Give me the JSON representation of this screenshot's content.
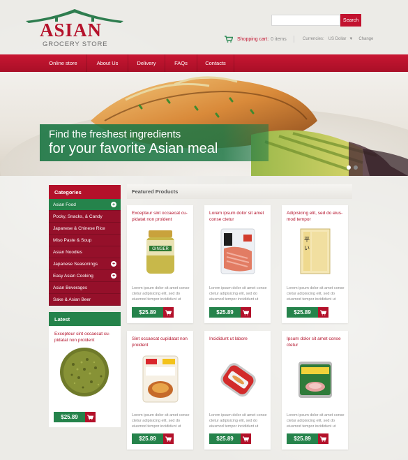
{
  "header": {
    "logo_title": "ASIAN",
    "logo_subtitle": "GROCERY STORE",
    "search": {
      "placeholder": "",
      "button_label": "Search"
    },
    "cart": {
      "label": "Shopping cart:",
      "count": "0 items",
      "icon": "cart-icon"
    },
    "currency": {
      "label": "Currencies:",
      "value": "US Dollar",
      "change_label": "Change"
    }
  },
  "nav": {
    "items": [
      {
        "label": "Online store",
        "active": true
      },
      {
        "label": "About Us",
        "active": false
      },
      {
        "label": "Delivery",
        "active": false
      },
      {
        "label": "FAQs",
        "active": false
      },
      {
        "label": "Contacts",
        "active": false
      }
    ]
  },
  "banner": {
    "line1": "Find the freshest ingredients",
    "line2": "for your favorite Asian meal",
    "slide_count": 2,
    "active_slide": 0
  },
  "sidebar": {
    "categories_title": "Categories",
    "categories": [
      {
        "label": "Asian Food",
        "active": true,
        "expandable": true
      },
      {
        "label": "Pocky, Snacks, & Candy",
        "active": false,
        "expandable": false
      },
      {
        "label": "Japanese & Chinese Rice",
        "active": false,
        "expandable": false
      },
      {
        "label": "Miso Paste & Soup",
        "active": false,
        "expandable": false
      },
      {
        "label": "Asian Noodles",
        "active": false,
        "expandable": false
      },
      {
        "label": "Japanese Seasonings",
        "active": false,
        "expandable": true
      },
      {
        "label": "Easy Asian Cooking",
        "active": false,
        "expandable": true
      },
      {
        "label": "Asian Beverages",
        "active": false,
        "expandable": false
      },
      {
        "label": "Sake & Asian Beer",
        "active": false,
        "expandable": false
      }
    ],
    "latest_title": "Latest",
    "latest": {
      "title": "Excepteur sint occaecat cu-pidatat non proident",
      "price": "$25.89"
    }
  },
  "featured": {
    "title": "Featured Products",
    "products": [
      {
        "title": "Excepteur sint occaecat cu-pidatat non proident",
        "desc": "Lorem ipsum dolor sit amet conse ctetur adipisicing elit, sed do eiusmod tempor incididunt ut",
        "price": "$25.89",
        "image": "ginger-jar"
      },
      {
        "title": "Lorem ipsum dolor sit amet conse ctetur",
        "desc": "Lorem ipsum dolor sit amet conse ctetur adipisicing elit, sed do eiusmod tempor incididunt ut",
        "price": "$25.89",
        "image": "noodle-pack"
      },
      {
        "title": "Adipisicing elit, sed do eius-mod tempor",
        "desc": "Lorem ipsum dolor sit amet conse ctetur adipisicing elit, sed do eiusmod tempor incididunt ut",
        "price": "$25.89",
        "image": "dried-noodles"
      },
      {
        "title": "Sint occaecat cupidatat non proident",
        "desc": "Lorem ipsum dolor sit amet conse ctetur adipisicing elit, sed do eiusmod tempor incididunt ut",
        "price": "$25.89",
        "image": "curry-pack"
      },
      {
        "title": "Incididunt ut labore",
        "desc": "Lorem ipsum dolor sit amet conse ctetur adipisicing elit, sed do eiusmod tempor incididunt ut",
        "price": "$25.89",
        "image": "sardine-tin"
      },
      {
        "title": "Ipsum dolor sit amet conse ctetur",
        "desc": "Lorem ipsum dolor sit amet conse ctetur adipisicing elit, sed do eiusmod tempor incididunt ut",
        "price": "$25.89",
        "image": "fortune-can"
      }
    ]
  },
  "colors": {
    "brand_red": "#b3112a",
    "accent_green": "#25834b"
  }
}
